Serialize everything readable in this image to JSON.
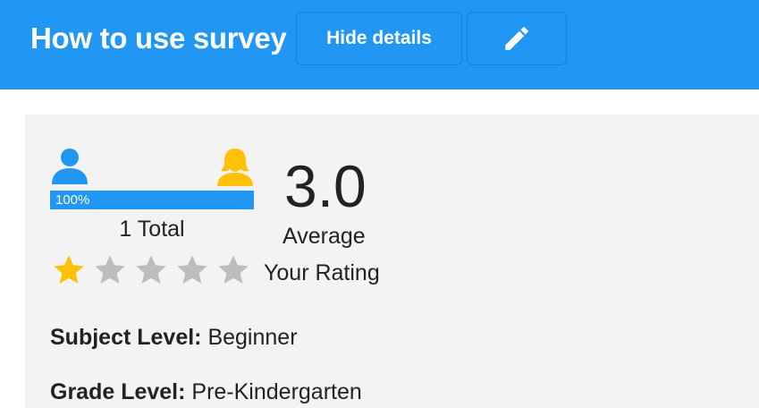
{
  "header": {
    "title": "How to use survey",
    "hide_details_label": "Hide details",
    "edit_icon": "pencil-icon",
    "background_color": "#2196f3"
  },
  "rating": {
    "gender_split_percent_label": "100%",
    "gender_split_fraction": 1.0,
    "total_label": "1 Total",
    "average_value": "3.0",
    "average_label": "Average",
    "your_rating_label": "Your Rating",
    "your_rating_stars": 1,
    "max_stars": 5,
    "star_filled_color": "#ffc107",
    "star_empty_color": "#bdbdbd",
    "male_icon_color": "#2196f3",
    "female_icon_color": "#ffc107"
  },
  "details": {
    "subject_level_label": "Subject Level:",
    "subject_level_value": "Beginner",
    "grade_level_label": "Grade Level:",
    "grade_level_value": "Pre-Kindergarten"
  }
}
